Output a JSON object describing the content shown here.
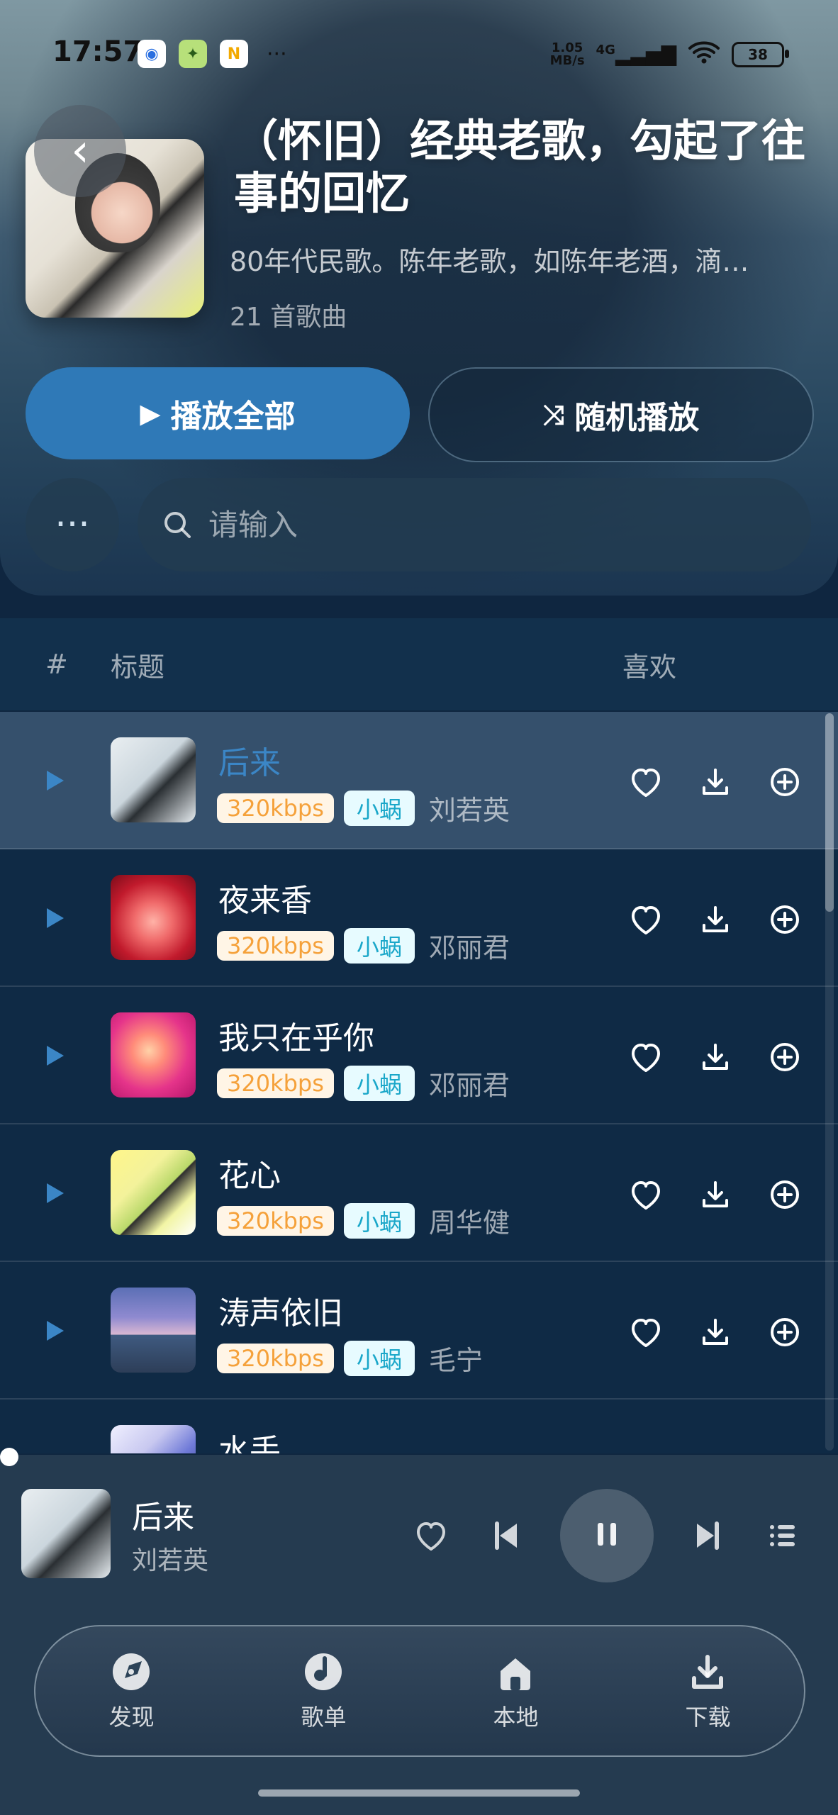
{
  "status_bar": {
    "time": "17:57",
    "netspeed_value": "1.05",
    "netspeed_unit": "MB/s",
    "network": "4G",
    "battery": "38"
  },
  "playlist": {
    "title": "（怀旧）经典老歌，勾起了往事的回忆",
    "description": "80年代民歌。陈年老歌，如陈年老酒，滴…",
    "count": "21 首歌曲"
  },
  "actions": {
    "play_all": "播放全部",
    "shuffle": "随机播放"
  },
  "search": {
    "placeholder": "请输入"
  },
  "list_header": {
    "index": "#",
    "title": "标题",
    "like": "喜欢"
  },
  "songs": [
    {
      "title": "后来",
      "quality": "320kbps",
      "source": "小蜗",
      "artist": "刘若英"
    },
    {
      "title": "夜来香",
      "quality": "320kbps",
      "source": "小蜗",
      "artist": "邓丽君"
    },
    {
      "title": "我只在乎你",
      "quality": "320kbps",
      "source": "小蜗",
      "artist": "邓丽君"
    },
    {
      "title": "花心",
      "quality": "320kbps",
      "source": "小蜗",
      "artist": "周华健"
    },
    {
      "title": "涛声依旧",
      "quality": "320kbps",
      "source": "小蜗",
      "artist": "毛宁"
    },
    {
      "title": "水手",
      "quality": "",
      "source": "",
      "artist": ""
    }
  ],
  "now_playing": {
    "title": "后来",
    "artist": "刘若英"
  },
  "bottom_nav": [
    {
      "label": "发现",
      "icon": "compass-icon"
    },
    {
      "label": "歌单",
      "icon": "disc-icon"
    },
    {
      "label": "本地",
      "icon": "home-icon"
    },
    {
      "label": "下载",
      "icon": "download-icon"
    }
  ],
  "colors": {
    "accent": "#2f79b7",
    "active_title": "#3b86c6",
    "quality_text": "#f5a13a",
    "source_text": "#1aa7c9"
  }
}
